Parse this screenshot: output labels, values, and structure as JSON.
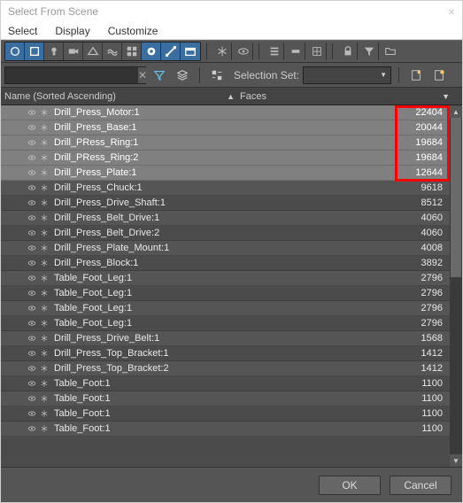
{
  "window": {
    "title": "Select From Scene"
  },
  "menubar": [
    "Select",
    "Display",
    "Customize"
  ],
  "toolbar2": {
    "selection_set_label": "Selection Set:"
  },
  "columns": {
    "name": "Name (Sorted Ascending)",
    "faces": "Faces"
  },
  "rows": [
    {
      "name": "Drill_Press_Motor:1",
      "faces": 22404,
      "selected": true
    },
    {
      "name": "Drill_Press_Base:1",
      "faces": 20044,
      "selected": true
    },
    {
      "name": "Drill_PRess_Ring:1",
      "faces": 19684,
      "selected": true
    },
    {
      "name": "Drill_PRess_Ring:2",
      "faces": 19684,
      "selected": true
    },
    {
      "name": "Drill_Press_Plate:1",
      "faces": 12644,
      "selected": true
    },
    {
      "name": "Drill_Press_Chuck:1",
      "faces": 9618,
      "selected": false
    },
    {
      "name": "Drill_Press_Drive_Shaft:1",
      "faces": 8512,
      "selected": false
    },
    {
      "name": "Drill_Press_Belt_Drive:1",
      "faces": 4060,
      "selected": false
    },
    {
      "name": "Drill_Press_Belt_Drive:2",
      "faces": 4060,
      "selected": false
    },
    {
      "name": "Drill_Press_Plate_Mount:1",
      "faces": 4008,
      "selected": false
    },
    {
      "name": "Drill_Press_Block:1",
      "faces": 3892,
      "selected": false
    },
    {
      "name": "Table_Foot_Leg:1",
      "faces": 2796,
      "selected": false
    },
    {
      "name": "Table_Foot_Leg:1",
      "faces": 2796,
      "selected": false
    },
    {
      "name": "Table_Foot_Leg:1",
      "faces": 2796,
      "selected": false
    },
    {
      "name": "Table_Foot_Leg:1",
      "faces": 2796,
      "selected": false
    },
    {
      "name": "Drill_Press_Drive_Belt:1",
      "faces": 1568,
      "selected": false
    },
    {
      "name": "Drill_Press_Top_Bracket:1",
      "faces": 1412,
      "selected": false
    },
    {
      "name": "Drill_Press_Top_Bracket:2",
      "faces": 1412,
      "selected": false
    },
    {
      "name": "Table_Foot:1",
      "faces": 1100,
      "selected": false
    },
    {
      "name": "Table_Foot:1",
      "faces": 1100,
      "selected": false
    },
    {
      "name": "Table_Foot:1",
      "faces": 1100,
      "selected": false
    },
    {
      "name": "Table_Foot:1",
      "faces": 1100,
      "selected": false
    }
  ],
  "highlight": {
    "top": 0,
    "height": 86,
    "right": 0,
    "width": 62
  },
  "footer": {
    "ok": "OK",
    "cancel": "Cancel"
  }
}
